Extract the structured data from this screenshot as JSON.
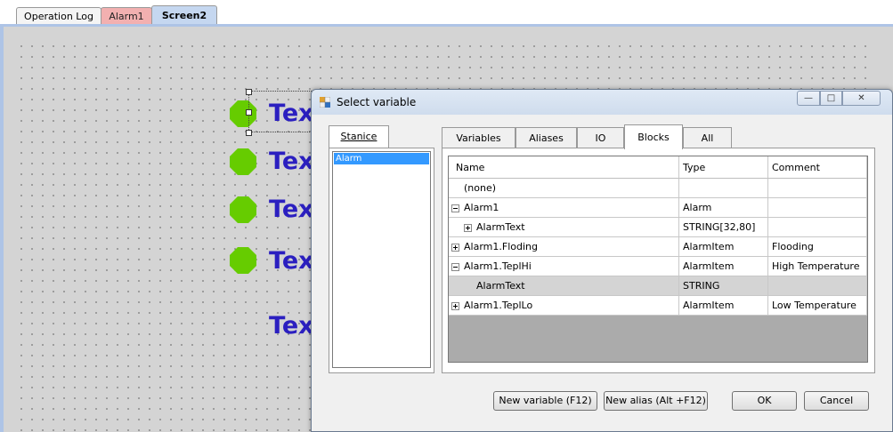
{
  "doc_tabs": {
    "operation_log": "Operation Log",
    "alarm1": "Alarm1",
    "screen2": "Screen2"
  },
  "canvas": {
    "text_items": [
      "Text",
      "Text",
      "Text",
      "Text",
      "Text"
    ],
    "lamp_color": "#66cc00",
    "text_color": "#2b1fc0"
  },
  "dialog": {
    "title": "Select variable",
    "min_glyph": "—",
    "max_glyph": "□",
    "close_glyph": "✕",
    "left_tab": "Stanice",
    "stations": [
      "Alarm"
    ],
    "tabs": [
      "Variables",
      "Aliases",
      "IO",
      "Blocks",
      "All"
    ],
    "active_tab": "Blocks",
    "columns": [
      "Name",
      "Type",
      "Comment"
    ],
    "rows": [
      {
        "name": "(none)",
        "type": "",
        "comment": "",
        "expander": "none"
      },
      {
        "name": "Alarm1",
        "type": "Alarm",
        "comment": "",
        "expander": "minus"
      },
      {
        "name": "AlarmText",
        "type": "STRING[32,80]",
        "comment": "",
        "expander": "plus"
      },
      {
        "name": "Alarm1.Floding",
        "type": "AlarmItem",
        "comment": "Flooding",
        "expander": "plus"
      },
      {
        "name": "Alarm1.TeplHi",
        "type": "AlarmItem",
        "comment": "High Temperature",
        "expander": "minus"
      },
      {
        "name": "AlarmText",
        "type": "STRING",
        "comment": "",
        "expander": "none"
      },
      {
        "name": "Alarm1.TeplLo",
        "type": "AlarmItem",
        "comment": "Low Temperature",
        "expander": "plus"
      }
    ],
    "buttons": {
      "new_variable": "New variable (F12)",
      "new_alias": "New alias (Alt +F12)",
      "ok": "OK",
      "cancel": "Cancel"
    }
  }
}
